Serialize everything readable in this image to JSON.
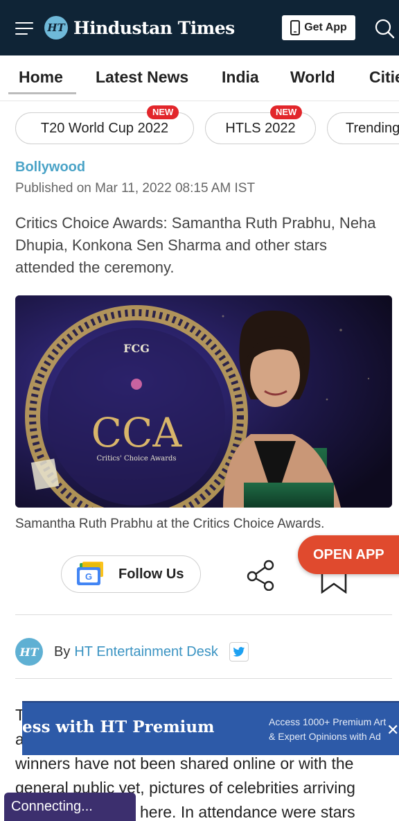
{
  "header": {
    "brand": "Hindustan Times",
    "logo_badge": "HT",
    "get_app_label": "Get App",
    "colors": {
      "background": "#0f2436",
      "badge": "#6fb9d9"
    }
  },
  "nav": {
    "items": [
      "Home",
      "Latest News",
      "India",
      "World",
      "Cities"
    ],
    "active": "Home"
  },
  "chips": [
    {
      "label": "T20 World Cup 2022",
      "badge": "NEW"
    },
    {
      "label": "HTLS 2022",
      "badge": "NEW"
    },
    {
      "label": "Trending"
    }
  ],
  "article": {
    "category": "Bollywood",
    "published": "Published on Mar 11, 2022 08:15 AM IST",
    "summary": "Critics Choice Awards: Samantha Ruth Prabhu, Neha Dhupia, Konkona Sen Sharma and other stars attended the ceremony.",
    "image_caption": "Samantha Ruth Prabhu at the Critics Choice Awards.",
    "image_text": {
      "main": "CCA",
      "sub": "Critics' Choice Awards",
      "top": "FCG"
    },
    "follow_label": "Follow Us",
    "open_app_label": "OPEN APP",
    "byline_prefix": "By",
    "author": "HT Entertainment Desk",
    "body_lines": [
      "T",
      "a",
      "winners have not been shared online or with the",
      "general public yet, pictures of celebrities arriving",
      "here. In attendance were stars"
    ]
  },
  "premium_banner": {
    "title": "ess with HT Premium",
    "line1": "Access 1000+ Premium Art",
    "line2": "& Expert Opinions with Ad"
  },
  "status": {
    "connecting": "Connecting..."
  }
}
